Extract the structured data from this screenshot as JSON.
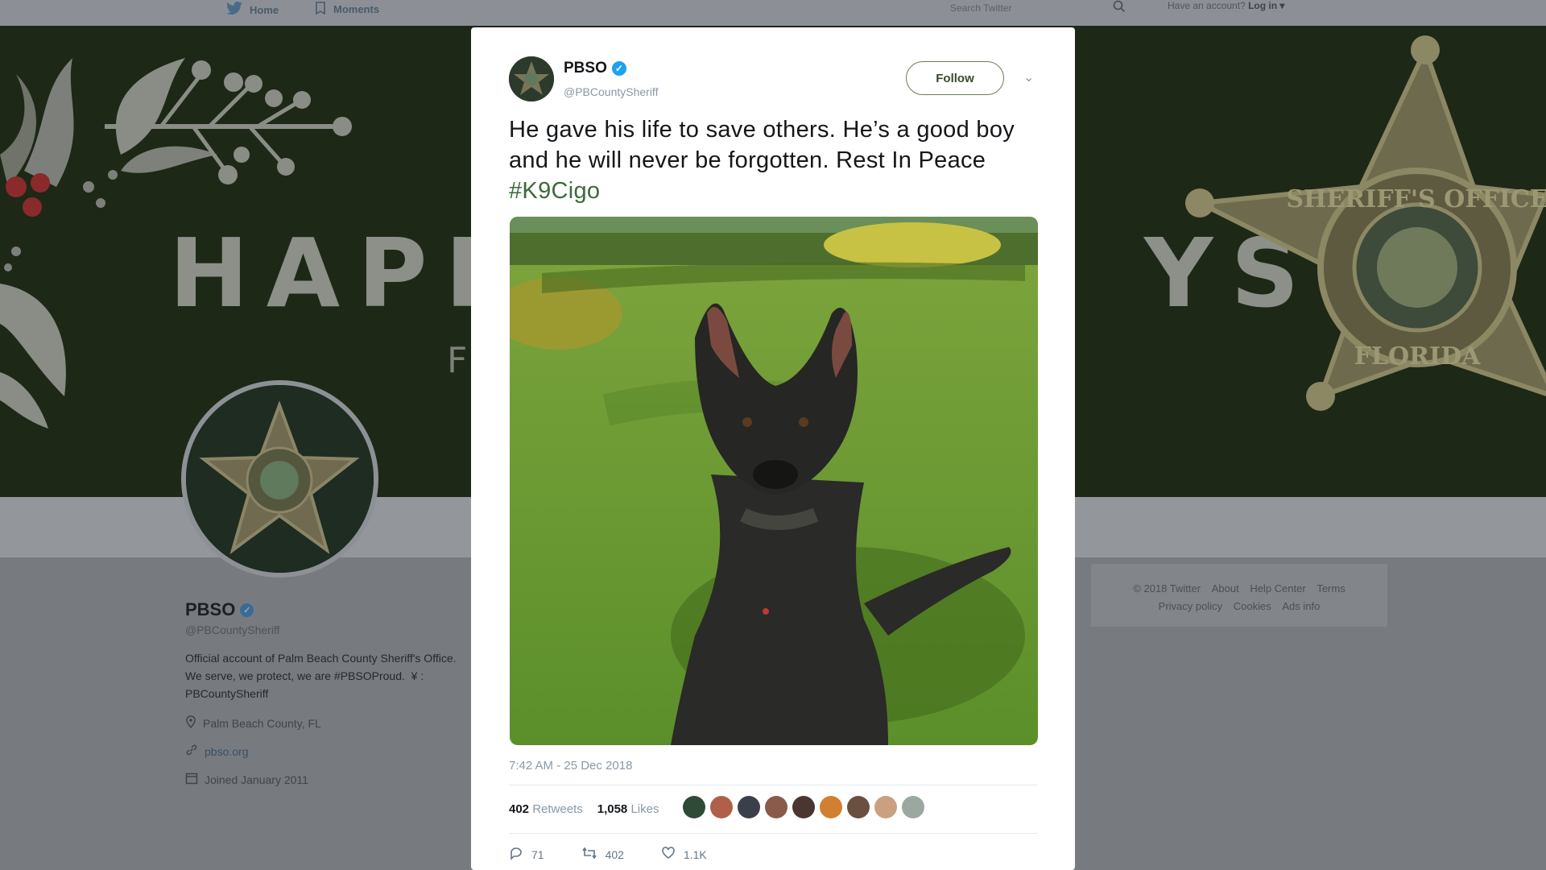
{
  "topnav": {
    "home": "Home",
    "moments": "Moments",
    "search_placeholder": "Search Twitter",
    "have_account": "Have an account?",
    "login": "Log in"
  },
  "banner": {
    "headline_left": "HAPP",
    "headline_right": "YS",
    "subline": "F"
  },
  "profile": {
    "name": "PBSO",
    "handle": "@PBCountySheriff",
    "bio": "Official account of Palm Beach County Sheriff's Office. We serve, we protect, we are #PBSOProud.  ¥ : PBCountySheriff",
    "location": "Palm Beach County, FL",
    "website": "pbso.org",
    "joined": "Joined January 2011"
  },
  "footer": {
    "row1": [
      "© 2018 Twitter",
      "About",
      "Help Center",
      "Terms"
    ],
    "row2": [
      "Privacy policy",
      "Cookies",
      "Ads info"
    ]
  },
  "tweet": {
    "name": "PBSO",
    "handle": "@PBCountySheriff",
    "follow_label": "Follow",
    "text_main": "He gave his life to save others. He’s a good boy and he will never be forgotten. Rest In Peace ",
    "hashtag": "#K9Cigo",
    "time": "7:42 AM - 25 Dec 2018",
    "retweets_count": "402",
    "retweets_label": "Retweets",
    "likes_count": "1,058",
    "likes_label": "Likes",
    "reply_count": "71",
    "retweet_action_count": "402",
    "like_action_count": "1.1K"
  },
  "colors": {
    "banner": "#1d2817",
    "verified": "#1da1f2",
    "hashtag": "#3b6b3a",
    "follow_border": "#6b7f54"
  },
  "icons": [
    "twitter-bird-icon",
    "moments-icon",
    "search-icon",
    "verified-icon",
    "chevron-down-icon",
    "location-icon",
    "link-icon",
    "calendar-icon",
    "reply-icon",
    "retweet-icon",
    "heart-icon"
  ]
}
